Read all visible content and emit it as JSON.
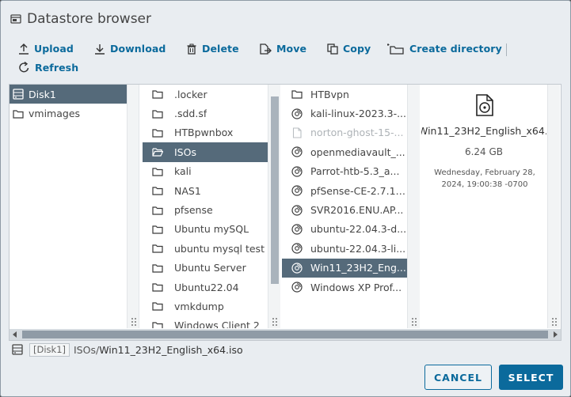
{
  "dialog": {
    "title": "Datastore browser"
  },
  "toolbar": {
    "upload": "Upload",
    "download": "Download",
    "delete": "Delete",
    "move": "Move",
    "copy": "Copy",
    "create_directory": "Create directory",
    "refresh": "Refresh"
  },
  "datastores": [
    {
      "label": "Disk1",
      "icon": "datastore-icon",
      "selected": true
    },
    {
      "label": "vmimages",
      "icon": "folder-icon",
      "selected": false
    }
  ],
  "folders": [
    {
      "label": ".locker",
      "selected": false
    },
    {
      "label": ".sdd.sf",
      "selected": false
    },
    {
      "label": "HTBpwnbox",
      "selected": false
    },
    {
      "label": "ISOs",
      "selected": true
    },
    {
      "label": "kali",
      "selected": false
    },
    {
      "label": "NAS1",
      "selected": false
    },
    {
      "label": "pfsense",
      "selected": false
    },
    {
      "label": "Ubuntu mySQL",
      "selected": false
    },
    {
      "label": "ubuntu mysql test",
      "selected": false
    },
    {
      "label": "Ubuntu Server",
      "selected": false
    },
    {
      "label": "Ubuntu22.04",
      "selected": false
    },
    {
      "label": "vmkdump",
      "selected": false
    },
    {
      "label": "Windows Client 2",
      "selected": false
    }
  ],
  "files": [
    {
      "label": "HTBvpn",
      "type": "folder",
      "selected": false,
      "disabled": false
    },
    {
      "label": "kali-linux-2023.3-...",
      "type": "disc",
      "selected": false,
      "disabled": false
    },
    {
      "label": "norton-ghost-15-...",
      "type": "file",
      "selected": false,
      "disabled": true
    },
    {
      "label": "openmediavault_...",
      "type": "disc",
      "selected": false,
      "disabled": false
    },
    {
      "label": "Parrot-htb-5.3_a...",
      "type": "disc",
      "selected": false,
      "disabled": false
    },
    {
      "label": "pfSense-CE-2.7.1-...",
      "type": "disc",
      "selected": false,
      "disabled": false
    },
    {
      "label": "SVR2016.ENU.AP...",
      "type": "disc",
      "selected": false,
      "disabled": false
    },
    {
      "label": "ubuntu-22.04.3-d...",
      "type": "disc",
      "selected": false,
      "disabled": false
    },
    {
      "label": "ubuntu-22.04.3-li...",
      "type": "disc",
      "selected": false,
      "disabled": false
    },
    {
      "label": "Win11_23H2_Eng...",
      "type": "disc",
      "selected": true,
      "disabled": false
    },
    {
      "label": "Windows XP Prof...",
      "type": "disc",
      "selected": false,
      "disabled": false
    }
  ],
  "preview": {
    "name": "Win11_23H2_English_x64.iso",
    "size": "6.24 GB",
    "modified": "Wednesday, February 28, 2024, 19:00:38 -0700"
  },
  "path": {
    "datastore": "[Disk1]",
    "directory": "ISOs/",
    "file": "Win11_23H2_English_x64.iso"
  },
  "buttons": {
    "cancel": "CANCEL",
    "select": "SELECT"
  },
  "scroll": {
    "folders_thumb_fraction": 0.77
  },
  "colors": {
    "accent": "#0b6a9c",
    "selection": "#556a7a"
  }
}
